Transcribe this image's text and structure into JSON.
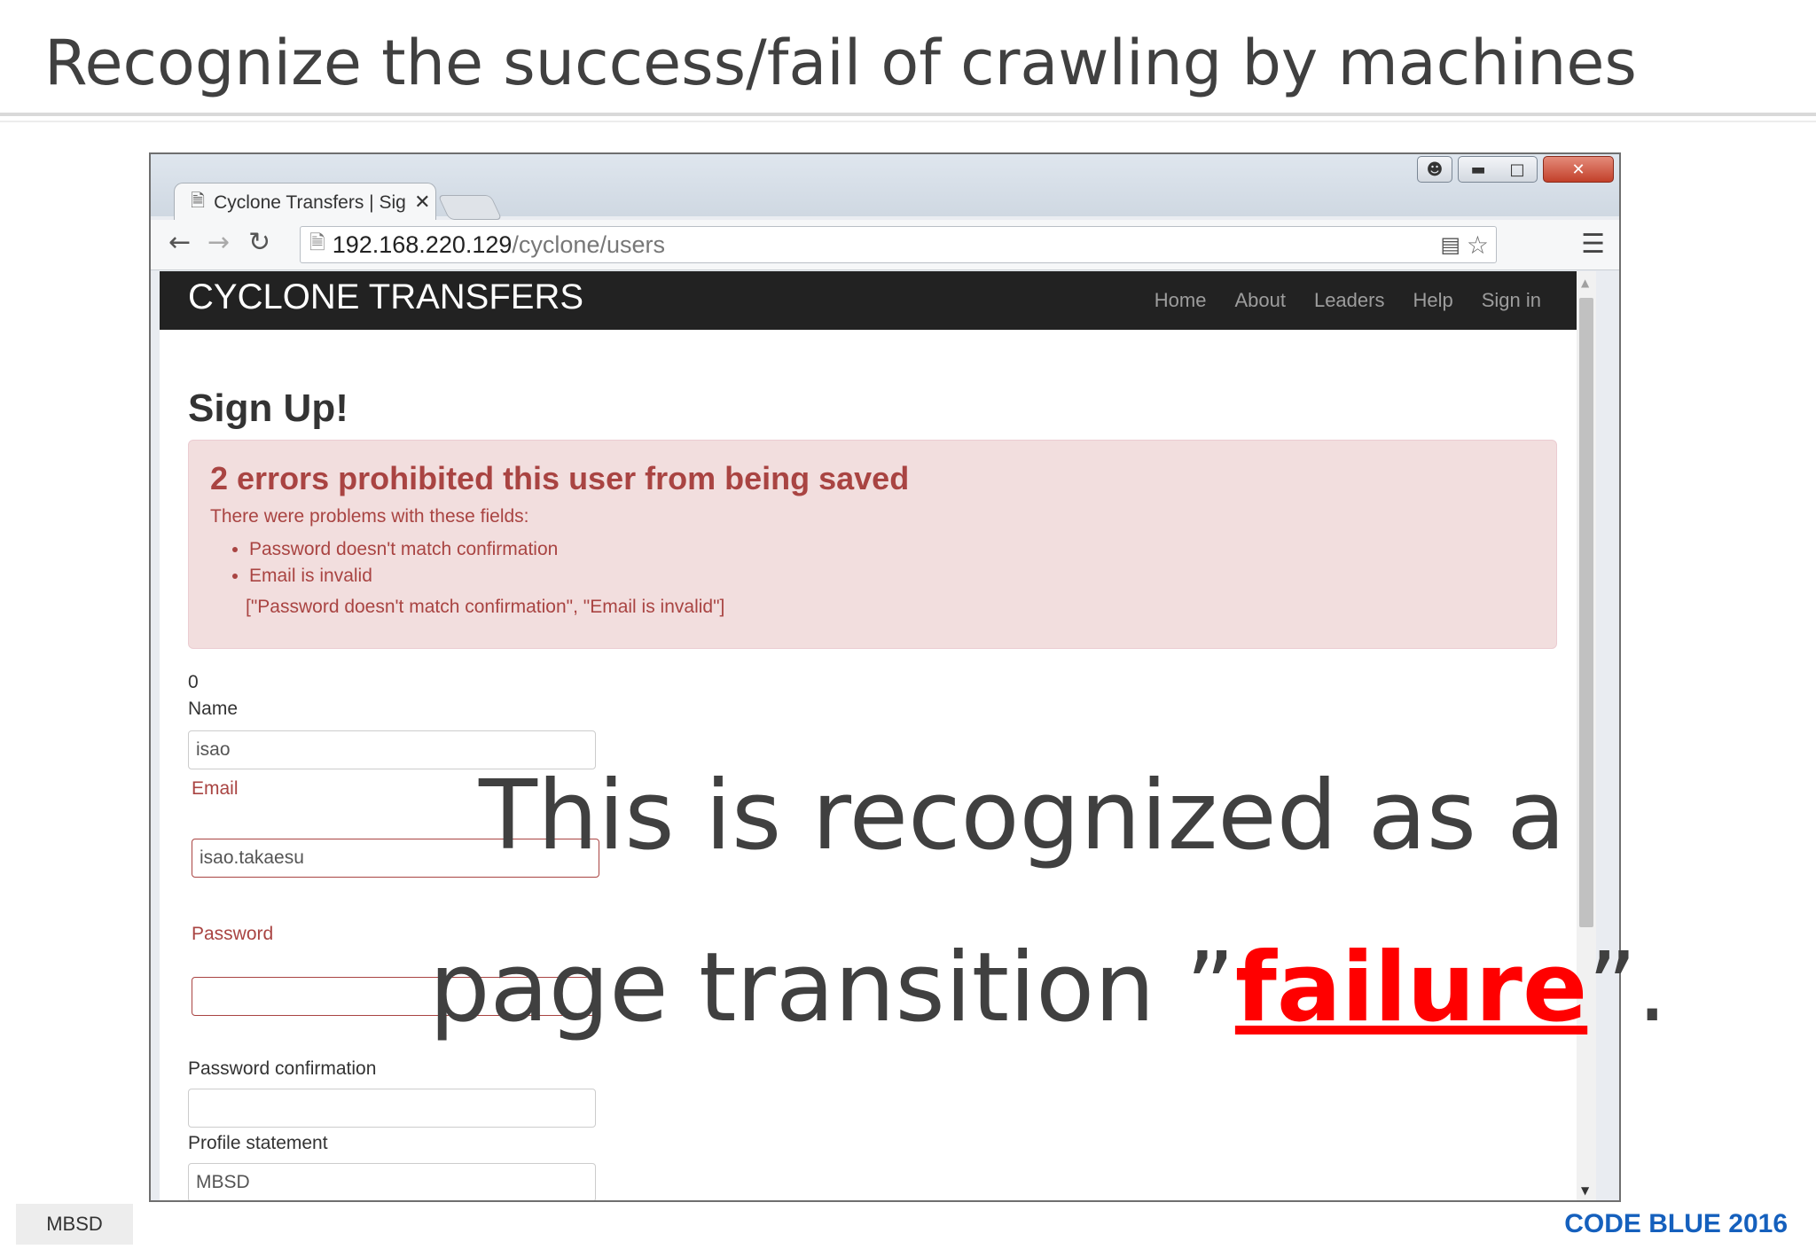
{
  "slide": {
    "title": "Recognize the success/fail of crawling by machines",
    "footer_left": "MBSD",
    "footer_right": "CODE BLUE 2016"
  },
  "browser": {
    "tab_title": "Cyclone Transfers | Sig",
    "url_host": "192.168.220.129",
    "url_path": "/cyclone/users"
  },
  "site": {
    "brand": "CYCLONE TRANSFERS",
    "nav": [
      "Home",
      "About",
      "Leaders",
      "Help",
      "Sign in"
    ],
    "heading": "Sign Up!",
    "alert": {
      "title": "2 errors prohibited this user from being saved",
      "subtitle": "There were problems with these fields:",
      "items": [
        "Password doesn't match confirmation",
        "Email is invalid"
      ],
      "raw": "[\"Password doesn't match confirmation\", \"Email is invalid\"]"
    },
    "form": {
      "counter": "0",
      "name_label": "Name",
      "name_value": "isao",
      "email_label": "Email",
      "email_value": "isao.takaesu",
      "password_label": "Password",
      "password_confirmation_label": "Password confirmation",
      "profile_label": "Profile statement",
      "profile_value": "MBSD"
    }
  },
  "caption": {
    "line1": "This is recognized as a",
    "line2_prefix": "page transition ”",
    "line2_emphasis": "failure",
    "line2_suffix": "”."
  },
  "colors": {
    "emphasis": "#ff0000",
    "brand_blue": "#1560bd",
    "error_text": "#a94442",
    "error_bg": "#f2dede"
  }
}
